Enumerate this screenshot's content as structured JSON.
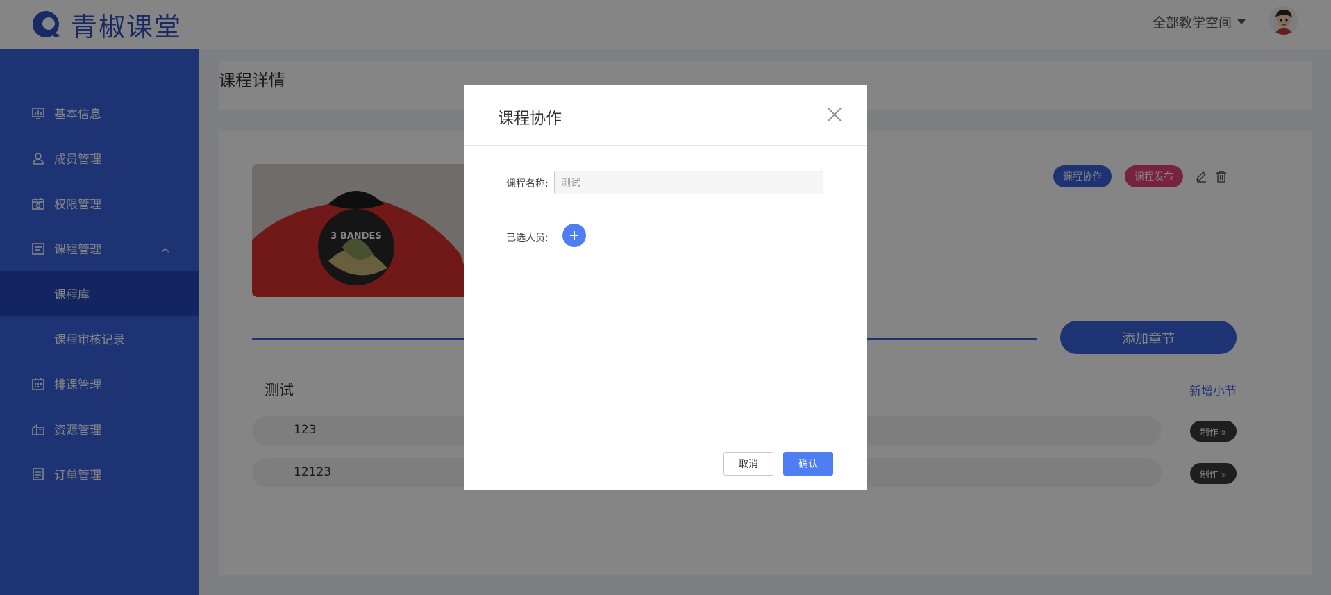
{
  "header": {
    "brand": "青椒课堂",
    "space_select": "全部教学空间"
  },
  "sidebar": {
    "items": [
      {
        "label": "基本信息",
        "icon": "chart-icon"
      },
      {
        "label": "成员管理",
        "icon": "user-icon"
      },
      {
        "label": "权限管理",
        "icon": "permission-icon"
      },
      {
        "label": "课程管理",
        "icon": "course-icon"
      },
      {
        "label": "课程库",
        "icon": ""
      },
      {
        "label": "课程审核记录",
        "icon": ""
      },
      {
        "label": "排课管理",
        "icon": "calendar-icon"
      },
      {
        "label": "资源管理",
        "icon": "resource-icon"
      },
      {
        "label": "订单管理",
        "icon": "order-icon"
      }
    ],
    "active_label": "课程库"
  },
  "main": {
    "page_title": "课程详情",
    "collab_button": "课程协作",
    "publish_button": "课程发布",
    "add_chapter_button": "添加章节",
    "chapter_title": "测试",
    "add_section_link": "新增小节",
    "lessons": [
      {
        "name": "123",
        "action": "制作 »"
      },
      {
        "name": "12123",
        "action": "制作 »"
      }
    ]
  },
  "modal": {
    "title": "课程协作",
    "course_name_label": "课程名称:",
    "course_name_value": "测试",
    "members_label": "已选人员:",
    "cancel_button": "取消",
    "confirm_button": "确认"
  },
  "colors": {
    "primary": "#3a63df",
    "publish": "#e5427a",
    "modal_primary": "#4f7ef2"
  }
}
